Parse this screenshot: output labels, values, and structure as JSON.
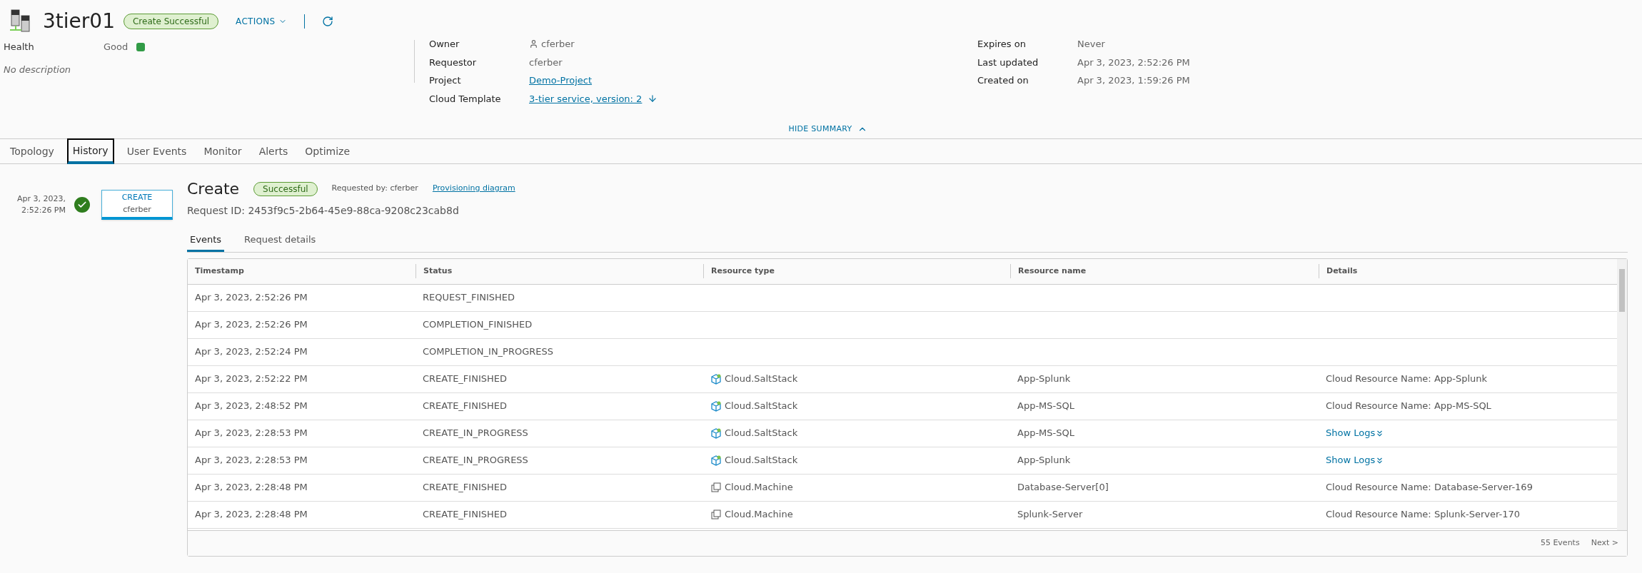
{
  "header": {
    "title": "3tier01",
    "status_badge": "Create Successful",
    "actions_label": "ACTIONS"
  },
  "summary": {
    "health_label": "Health",
    "health_value": "Good",
    "healthy": true,
    "description": "No description",
    "middle": [
      {
        "label": "Owner",
        "value": "cferber",
        "kind": "user"
      },
      {
        "label": "Requestor",
        "value": "cferber",
        "kind": "text"
      },
      {
        "label": "Project",
        "value": "Demo-Project",
        "kind": "link"
      },
      {
        "label": "Cloud Template",
        "value": "3-tier service, version: 2",
        "kind": "download"
      }
    ],
    "right": [
      {
        "label": "Expires on",
        "value": "Never"
      },
      {
        "label": "Last updated",
        "value": "Apr 3, 2023, 2:52:26 PM"
      },
      {
        "label": "Created on",
        "value": "Apr 3, 2023, 1:59:26 PM"
      }
    ],
    "hide_summary": "HIDE SUMMARY"
  },
  "tabs": [
    {
      "label": "Topology",
      "selected": false
    },
    {
      "label": "History",
      "selected": true
    },
    {
      "label": "User Events",
      "selected": false
    },
    {
      "label": "Monitor",
      "selected": false
    },
    {
      "label": "Alerts",
      "selected": false
    },
    {
      "label": "Optimize",
      "selected": false
    }
  ],
  "timeline": [
    {
      "date": "Apr 3, 2023,",
      "time": "2:52:26 PM",
      "action": "CREATE",
      "user": "cferber",
      "selected": true
    }
  ],
  "request": {
    "title": "Create",
    "status": "Successful",
    "requested_by": "Requested by: cferber",
    "diagram_link": "Provisioning diagram",
    "request_id": "Request ID: 2453f9c5-2b64-45e9-88ca-9208c23cab8d"
  },
  "subtabs": [
    {
      "label": "Events",
      "selected": true
    },
    {
      "label": "Request details",
      "selected": false
    }
  ],
  "table": {
    "columns": [
      "Timestamp",
      "Status",
      "Resource type",
      "Resource name",
      "Details"
    ],
    "rows": [
      {
        "timestamp": "Apr 3, 2023, 2:52:26 PM",
        "status": "REQUEST_FINISHED"
      },
      {
        "timestamp": "Apr 3, 2023, 2:52:26 PM",
        "status": "COMPLETION_FINISHED"
      },
      {
        "timestamp": "Apr 3, 2023, 2:52:24 PM",
        "status": "COMPLETION_IN_PROGRESS"
      },
      {
        "timestamp": "Apr 3, 2023, 2:52:22 PM",
        "status": "CREATE_FINISHED",
        "resource_type": {
          "kind": "saltstack",
          "label": "Cloud.SaltStack"
        },
        "resource_name": "App-Splunk",
        "details": {
          "kind": "text",
          "text": "Cloud Resource Name: App-Splunk"
        }
      },
      {
        "timestamp": "Apr 3, 2023, 2:48:52 PM",
        "status": "CREATE_FINISHED",
        "resource_type": {
          "kind": "saltstack",
          "label": "Cloud.SaltStack"
        },
        "resource_name": "App-MS-SQL",
        "details": {
          "kind": "text",
          "text": "Cloud Resource Name: App-MS-SQL"
        }
      },
      {
        "timestamp": "Apr 3, 2023, 2:28:53 PM",
        "status": "CREATE_IN_PROGRESS",
        "resource_type": {
          "kind": "saltstack",
          "label": "Cloud.SaltStack"
        },
        "resource_name": "App-MS-SQL",
        "details": {
          "kind": "logs",
          "text": "Show Logs"
        }
      },
      {
        "timestamp": "Apr 3, 2023, 2:28:53 PM",
        "status": "CREATE_IN_PROGRESS",
        "resource_type": {
          "kind": "saltstack",
          "label": "Cloud.SaltStack"
        },
        "resource_name": "App-Splunk",
        "details": {
          "kind": "logs",
          "text": "Show Logs"
        }
      },
      {
        "timestamp": "Apr 3, 2023, 2:28:48 PM",
        "status": "CREATE_FINISHED",
        "resource_type": {
          "kind": "machine",
          "label": "Cloud.Machine"
        },
        "resource_name": "Database-Server[0]",
        "details": {
          "kind": "text",
          "text": "Cloud Resource Name: Database-Server-169"
        }
      },
      {
        "timestamp": "Apr 3, 2023, 2:28:48 PM",
        "status": "CREATE_FINISHED",
        "resource_type": {
          "kind": "machine",
          "label": "Cloud.Machine"
        },
        "resource_name": "Splunk-Server",
        "details": {
          "kind": "text",
          "text": "Cloud Resource Name: Splunk-Server-170"
        }
      }
    ],
    "footer": {
      "count": "55 Events",
      "next": "Next >"
    }
  }
}
